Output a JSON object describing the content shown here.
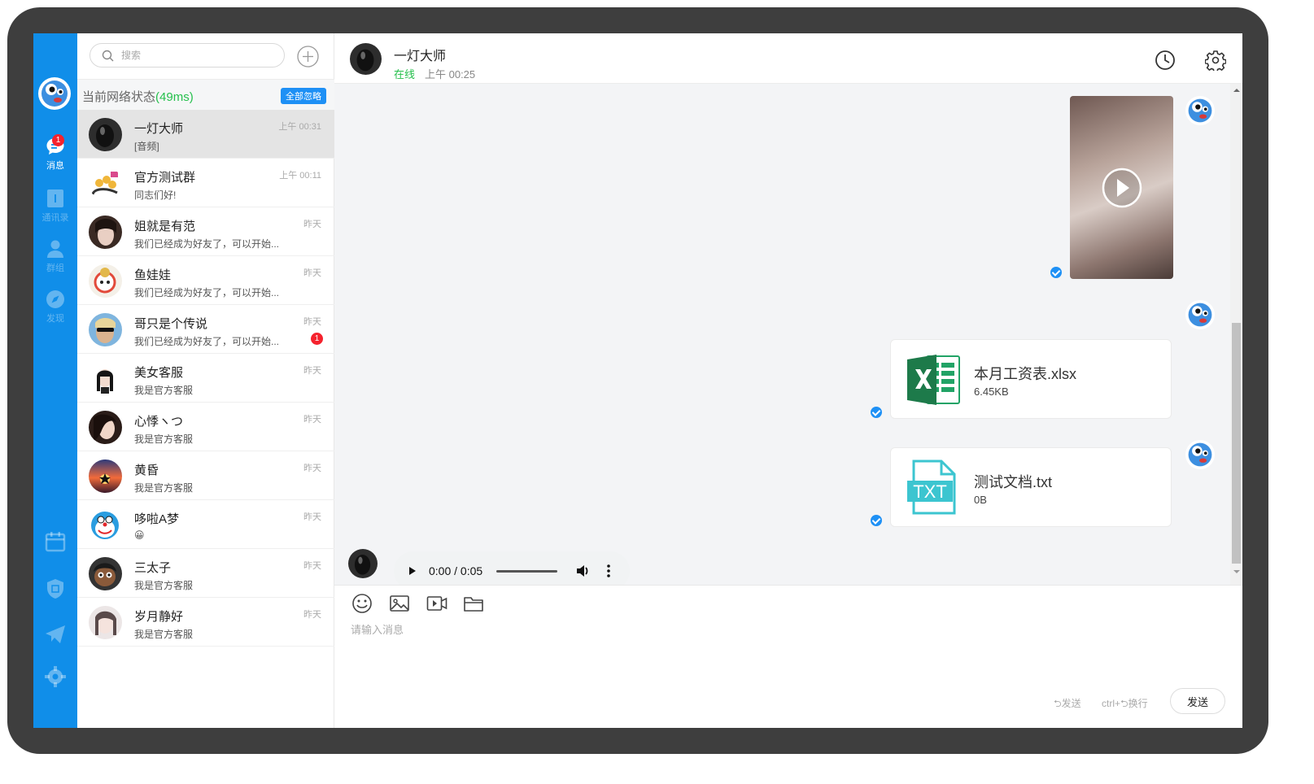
{
  "nav": {
    "items": [
      {
        "label": "消息",
        "badge": "1",
        "icon": "message-icon"
      },
      {
        "label": "通讯录",
        "icon": "contacts-icon"
      },
      {
        "label": "群组",
        "icon": "group-icon"
      },
      {
        "label": "发现",
        "icon": "discover-icon"
      }
    ],
    "bottom_icons": [
      "calendar-icon",
      "shield-icon",
      "send-icon",
      "settings-gear-icon"
    ]
  },
  "search": {
    "placeholder": "搜索"
  },
  "network": {
    "label": "当前网络状态",
    "latency": "(49ms)",
    "ignore_all": "全部忽略"
  },
  "conversations": [
    {
      "name": "一灯大师",
      "preview": "[音频]",
      "time": "上午 00:31"
    },
    {
      "name": "官方测试群",
      "preview": "同志们好!",
      "time": "上午 00:11"
    },
    {
      "name": "姐就是有范",
      "preview": "我们已经成为好友了，可以开始...",
      "time": "昨天"
    },
    {
      "name": "鱼娃娃",
      "preview": "我们已经成为好友了，可以开始...",
      "time": "昨天"
    },
    {
      "name": "哥只是个传说",
      "preview": "我们已经成为好友了，可以开始...",
      "time": "昨天",
      "badge": "1"
    },
    {
      "name": "美女客服",
      "preview": "我是官方客服",
      "time": "昨天"
    },
    {
      "name": "心悸ヽつ",
      "preview": "我是官方客服",
      "time": "昨天"
    },
    {
      "name": "黄昏",
      "preview": "我是官方客服",
      "time": "昨天"
    },
    {
      "name": "哆啦A梦",
      "preview": "😀",
      "time": "昨天"
    },
    {
      "name": "三太子",
      "preview": "我是官方客服",
      "time": "昨天"
    },
    {
      "name": "岁月静好",
      "preview": "我是官方客服",
      "time": "昨天"
    }
  ],
  "chat": {
    "name": "一灯大师",
    "status": "在线",
    "time": "上午 00:25",
    "files": [
      {
        "name": "本月工资表.xlsx",
        "size": "6.45KB",
        "type": "excel-file-icon"
      },
      {
        "name": "测试文档.txt",
        "size": "0B",
        "type": "txt-file-icon",
        "icon_text": "TXT"
      }
    ],
    "audio": {
      "time": "0:00 / 0:05"
    }
  },
  "composer": {
    "placeholder": "请输入消息",
    "hint_send": "⮌发送",
    "hint_newline": "ctrl+⮌换行",
    "send_label": "发送"
  },
  "colors": {
    "nav_bg": "#108ee9",
    "accent": "#1e90f5",
    "online": "#26c04d",
    "badge": "#f5222d"
  }
}
